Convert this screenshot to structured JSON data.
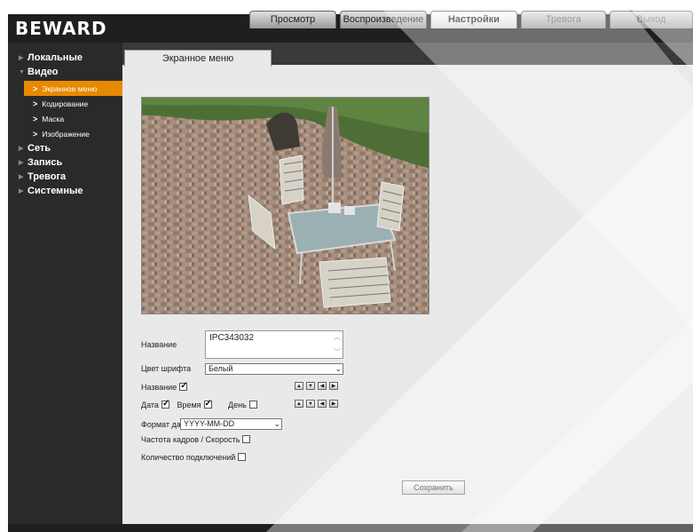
{
  "header": {
    "logo": "BEWARD",
    "tabs": [
      {
        "label": "Просмотр",
        "state": "normal"
      },
      {
        "label": "Воспроизведение",
        "state": "normal"
      },
      {
        "label": "Настройки",
        "state": "active"
      },
      {
        "label": "Тревога",
        "state": "dim"
      },
      {
        "label": "Выход",
        "state": "dim"
      }
    ]
  },
  "sidebar": {
    "items": [
      {
        "label": "Локальные"
      },
      {
        "label": "Видео",
        "expanded": true,
        "children": [
          {
            "label": "Экранное меню",
            "active": true
          },
          {
            "label": "Кодирование"
          },
          {
            "label": "Маска"
          },
          {
            "label": "Изображение"
          }
        ]
      },
      {
        "label": "Сеть"
      },
      {
        "label": "Запись"
      },
      {
        "label": "Тревога"
      },
      {
        "label": "Системные"
      }
    ]
  },
  "page": {
    "subtab": "Экранное меню"
  },
  "form": {
    "name_label": "Название",
    "name_value": "IPC343032",
    "font_color_label": "Цвет шрифта",
    "font_color_value": "Белый",
    "name_show_label": "Название",
    "name_show_checked": true,
    "date_label": "Дата",
    "date_checked": true,
    "time_label": "Время",
    "time_checked": true,
    "day_label": "День",
    "day_checked": false,
    "date_format_label": "Формат даты",
    "date_format_value": "YYYY-MM-DD",
    "fps_label": "Частота кадров / Скорость",
    "fps_checked": false,
    "connections_label": "Количество подключений",
    "connections_checked": false,
    "save_label": "Сохранить"
  },
  "colors": {
    "accent": "#e88a00",
    "header_bg": "#1f1f1f",
    "sidebar_bg": "#2a2a2a",
    "content_bg": "#e9e9e9"
  }
}
